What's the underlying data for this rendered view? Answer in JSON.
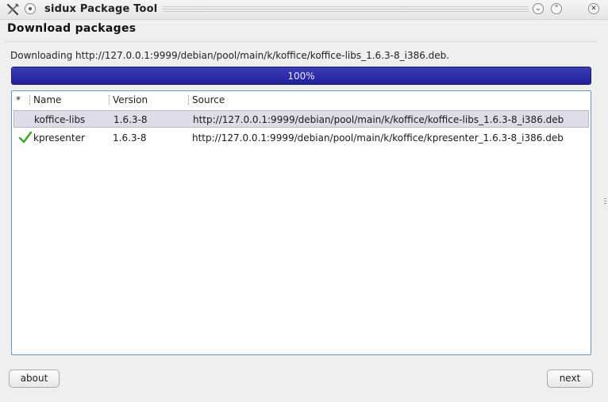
{
  "window": {
    "title": "sidux Package Tool",
    "minimize_glyph": "⌄",
    "maximize_glyph": "⌃",
    "close_glyph": "✕"
  },
  "page": {
    "heading": "Download packages",
    "status_text": "Downloading http://127.0.0.1:9999/debian/pool/main/k/koffice/koffice-libs_1.6.3-8_i386.deb."
  },
  "progress": {
    "percent": 100,
    "label": "100%",
    "color": "#2a2aa8"
  },
  "list": {
    "headers": {
      "status": "*",
      "name": "Name",
      "version": "Version",
      "source": "Source"
    },
    "rows": [
      {
        "status_icon": "",
        "name": "koffice-libs",
        "version": "1.6.3-8",
        "source": "http://127.0.0.1:9999/debian/pool/main/k/koffice/koffice-libs_1.6.3-8_i386.deb",
        "selected": true
      },
      {
        "status_icon": "check-icon",
        "name": "kpresenter",
        "version": "1.6.3-8",
        "source": "http://127.0.0.1:9999/debian/pool/main/k/koffice/kpresenter_1.6.3-8_i386.deb",
        "selected": false
      }
    ]
  },
  "buttons": {
    "about": "about",
    "next": "next"
  },
  "colors": {
    "accent": "#2a2aa8",
    "check": "#3aa52b",
    "selection": "#dedce9"
  }
}
